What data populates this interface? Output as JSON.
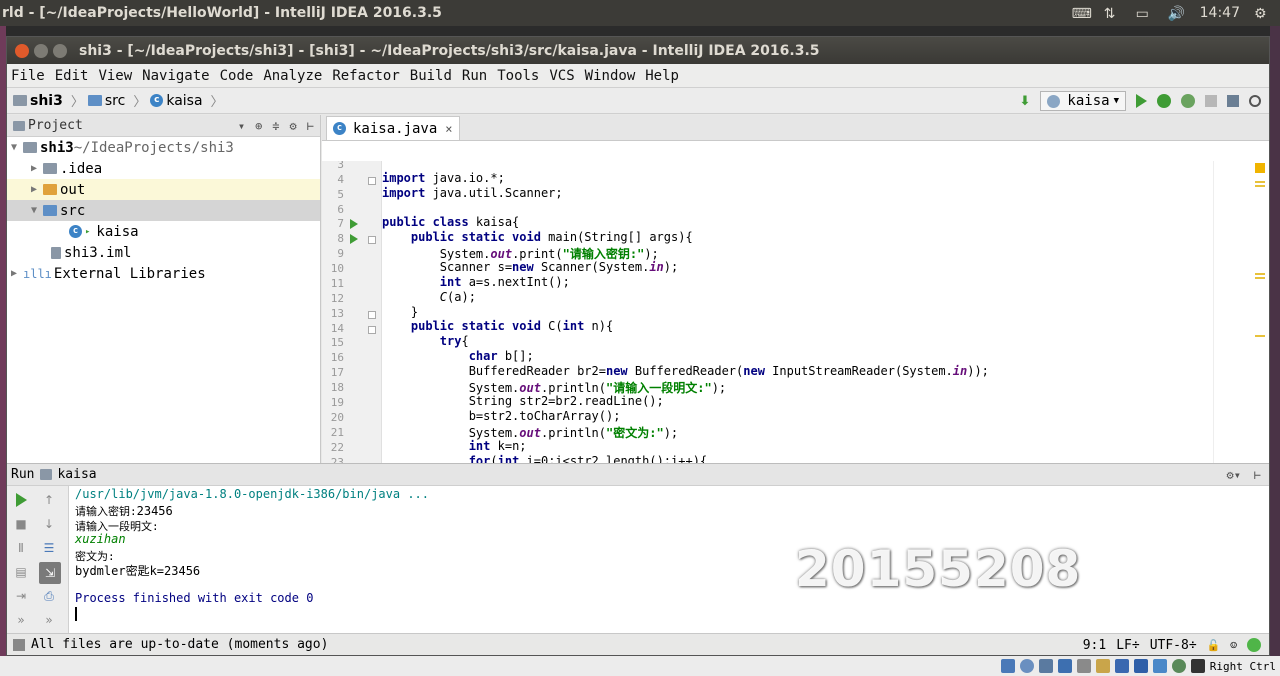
{
  "desktop": {
    "topbar_title": "rld - [~/IdeaProjects/HelloWorld] - IntelliJ IDEA 2016.3.5",
    "clock": "14:47"
  },
  "window": {
    "title": "shi3 - [~/IdeaProjects/shi3] - [shi3] - ~/IdeaProjects/shi3/src/kaisa.java - IntelliJ IDEA 2016.3.5"
  },
  "menu": [
    "File",
    "Edit",
    "View",
    "Navigate",
    "Code",
    "Analyze",
    "Refactor",
    "Build",
    "Run",
    "Tools",
    "VCS",
    "Window",
    "Help"
  ],
  "breadcrumb": [
    "shi3",
    "src",
    "kaisa"
  ],
  "run_config": "kaisa",
  "project": {
    "header": "Project",
    "tree": [
      {
        "label": "shi3",
        "suffix": " ~/IdeaProjects/shi3"
      },
      {
        "label": ".idea"
      },
      {
        "label": "out"
      },
      {
        "label": "src"
      },
      {
        "label": "kaisa"
      },
      {
        "label": "shi3.iml"
      },
      {
        "label": "External Libraries"
      }
    ]
  },
  "editor": {
    "tab": "kaisa.java",
    "line_numbers": [
      "3",
      "4",
      "5",
      "6",
      "7",
      "8",
      "9",
      "10",
      "11",
      "12",
      "13",
      "14",
      "15",
      "16",
      "17",
      "18",
      "19",
      "20",
      "21",
      "22",
      "23"
    ]
  },
  "run": {
    "label": "Run",
    "config": "kaisa",
    "console": {
      "cmd": "/usr/lib/jvm/java-1.8.0-openjdk-i386/bin/java ...",
      "prompt_key": "请输入密钥:",
      "key_input": "23456",
      "prompt_text": "请输入一段明文:",
      "text_input": "xuzihan",
      "cipher_label": "密文为:",
      "cipher_output": "bydmler密匙k=23456",
      "finished": "Process finished with exit code 0"
    }
  },
  "watermark": "20155208",
  "status": {
    "message": "All files are up-to-date (moments ago)",
    "position": "9:1",
    "line_sep": "LF÷",
    "encoding": "UTF-8÷"
  },
  "vm": {
    "host_key": "Right Ctrl"
  }
}
